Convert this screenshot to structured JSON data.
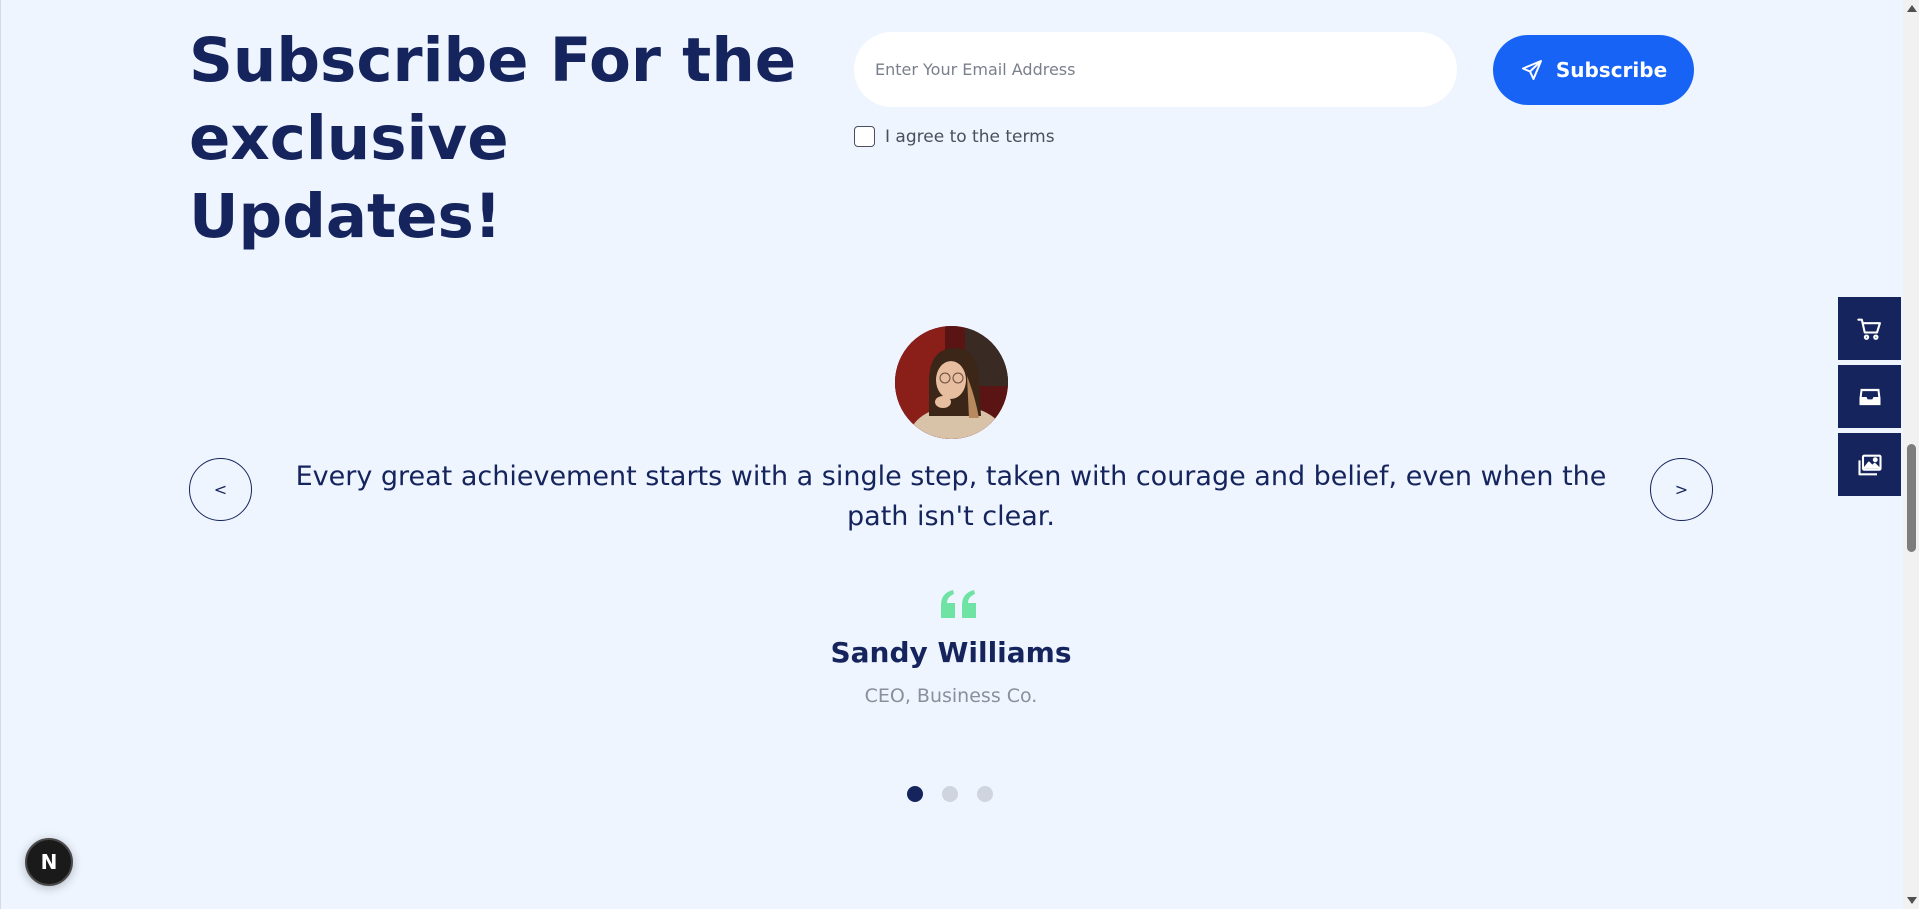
{
  "subscribe": {
    "title": "Subscribe For the exclusive Updates!",
    "email_placeholder": "Enter Your Email Address",
    "email_value": "",
    "agree_label": "I agree to the terms",
    "agree_checked": false,
    "button_label": "Subscribe",
    "button_icon": "paper-plane-icon"
  },
  "side_panel": {
    "items": [
      {
        "icon": "cart-icon"
      },
      {
        "icon": "inbox-icon"
      },
      {
        "icon": "images-icon"
      }
    ]
  },
  "testimonial": {
    "quote": "Every great achievement starts with a single step, taken with courage and belief, even when the path isn't clear.",
    "name": "Sandy Williams",
    "role": "CEO, Business Co.",
    "prev_label": "<",
    "next_label": ">",
    "active_slide": 1,
    "slide_count": 3,
    "quote_icon": "quote-icon"
  },
  "next_badge": {
    "label": "N"
  },
  "colors": {
    "background": "#eef5ff",
    "navy": "#15245c",
    "accent_blue": "#1763f5",
    "quote_green": "#6fe3a4",
    "dot_inactive": "#cfd4de"
  }
}
